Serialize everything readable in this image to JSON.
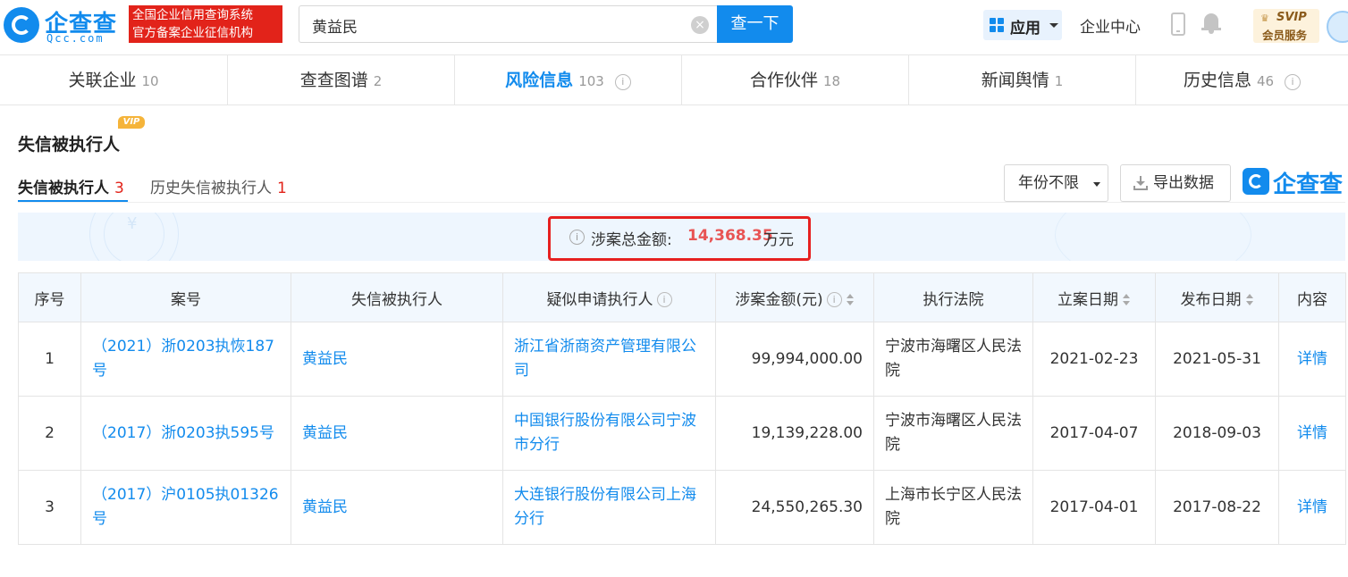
{
  "header": {
    "logo_name": "企查查",
    "logo_sub": "Qcc.com",
    "slogan_line1": "全国企业信用查询系统",
    "slogan_line2": "官方备案企业征信机构",
    "search_value": "黄益民",
    "search_button": "查一下",
    "app_label": "应用",
    "enterprise_center": "企业中心",
    "svip_line1": "SVIP",
    "svip_line2": "会员服务"
  },
  "tabs": [
    {
      "label": "关联企业",
      "count": "10"
    },
    {
      "label": "查查图谱",
      "count": "2"
    },
    {
      "label": "风险信息",
      "count": "103"
    },
    {
      "label": "合作伙伴",
      "count": "18"
    },
    {
      "label": "新闻舆情",
      "count": "1"
    },
    {
      "label": "历史信息",
      "count": "46"
    }
  ],
  "section": {
    "vip_tag": "VIP",
    "title": "失信被执行人",
    "subtab1_label": "失信被执行人",
    "subtab1_count": "3",
    "subtab2_label": "历史失信被执行人",
    "subtab2_count": "1",
    "year_filter": "年份不限",
    "export_label": "导出数据",
    "watermark": "企查查"
  },
  "summary": {
    "label": "涉案总金额:",
    "value": "14,368.35",
    "unit": "万元",
    "yen": "¥"
  },
  "table": {
    "headers": [
      "序号",
      "案号",
      "失信被执行人",
      "疑似申请执行人",
      "涉案金额(元)",
      "执行法院",
      "立案日期",
      "发布日期",
      "内容"
    ],
    "rows": [
      {
        "no": "1",
        "case_no": "（2021）浙0203执恢187号",
        "person": "黄益民",
        "applicant": "浙江省浙商资产管理有限公司",
        "amount": "99,994,000.00",
        "court": "宁波市海曙区人民法院",
        "filed": "2021-02-23",
        "published": "2021-05-31",
        "detail": "详情"
      },
      {
        "no": "2",
        "case_no": "（2017）浙0203执595号",
        "person": "黄益民",
        "applicant": "中国银行股份有限公司宁波市分行",
        "amount": "19,139,228.00",
        "court": "宁波市海曙区人民法院",
        "filed": "2017-04-07",
        "published": "2018-09-03",
        "detail": "详情"
      },
      {
        "no": "3",
        "case_no": "（2017）沪0105执01326号",
        "person": "黄益民",
        "applicant": "大连银行股份有限公司上海分行",
        "amount": "24,550,265.30",
        "court": "上海市长宁区人民法院",
        "filed": "2017-04-01",
        "published": "2017-08-22",
        "detail": "详情"
      }
    ]
  },
  "colors": {
    "brand_blue": "#128bed",
    "alert_red": "#e62020",
    "amount_red": "#e85454"
  }
}
